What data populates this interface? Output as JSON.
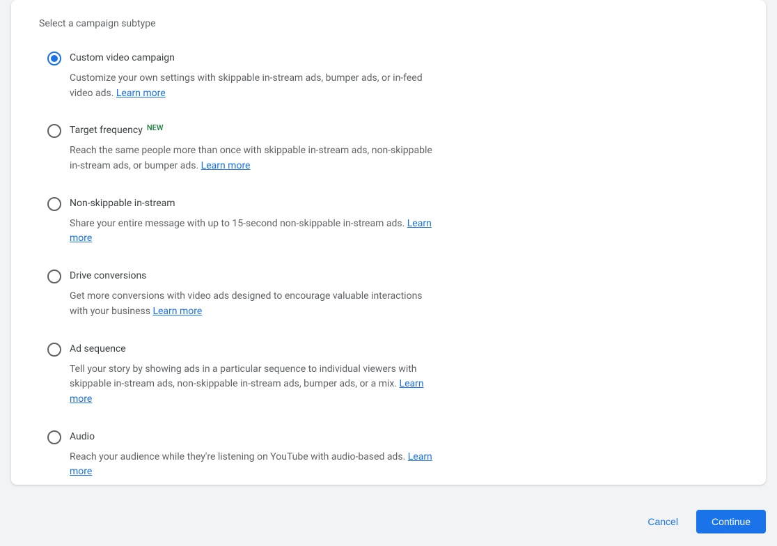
{
  "colors": {
    "accent": "#1a73e8",
    "radioBorder": "#5f6368",
    "newBadge": "#188038"
  },
  "card": {
    "title": "Select a campaign subtype"
  },
  "learnMoreLabel": "Learn more",
  "newLabel": "NEW",
  "options": [
    {
      "id": "custom-video",
      "selected": true,
      "isNew": false,
      "title": "Custom video campaign",
      "desc": "Customize your own settings with skippable in-stream ads, bumper ads, or in-feed video ads."
    },
    {
      "id": "target-frequency",
      "selected": false,
      "isNew": true,
      "title": "Target frequency",
      "desc": "Reach the same people more than once with skippable in-stream ads, non-skippable in-stream ads, or bumper ads."
    },
    {
      "id": "non-skippable",
      "selected": false,
      "isNew": false,
      "title": "Non-skippable in-stream",
      "desc": "Share your entire message with up to 15-second non-skippable in-stream ads."
    },
    {
      "id": "drive-conversions",
      "selected": false,
      "isNew": false,
      "title": "Drive conversions",
      "desc": "Get more conversions with video ads designed to encourage valuable interactions with your business"
    },
    {
      "id": "ad-sequence",
      "selected": false,
      "isNew": false,
      "title": "Ad sequence",
      "desc": "Tell your story by showing ads in a particular sequence to individual viewers with skippable in-stream ads, non-skippable in-stream ads, bumper ads, or a mix."
    },
    {
      "id": "audio",
      "selected": false,
      "isNew": false,
      "title": "Audio",
      "desc": "Reach your audience while they're listening on YouTube with audio-based ads."
    }
  ],
  "actions": {
    "cancel": "Cancel",
    "continue": "Continue"
  }
}
